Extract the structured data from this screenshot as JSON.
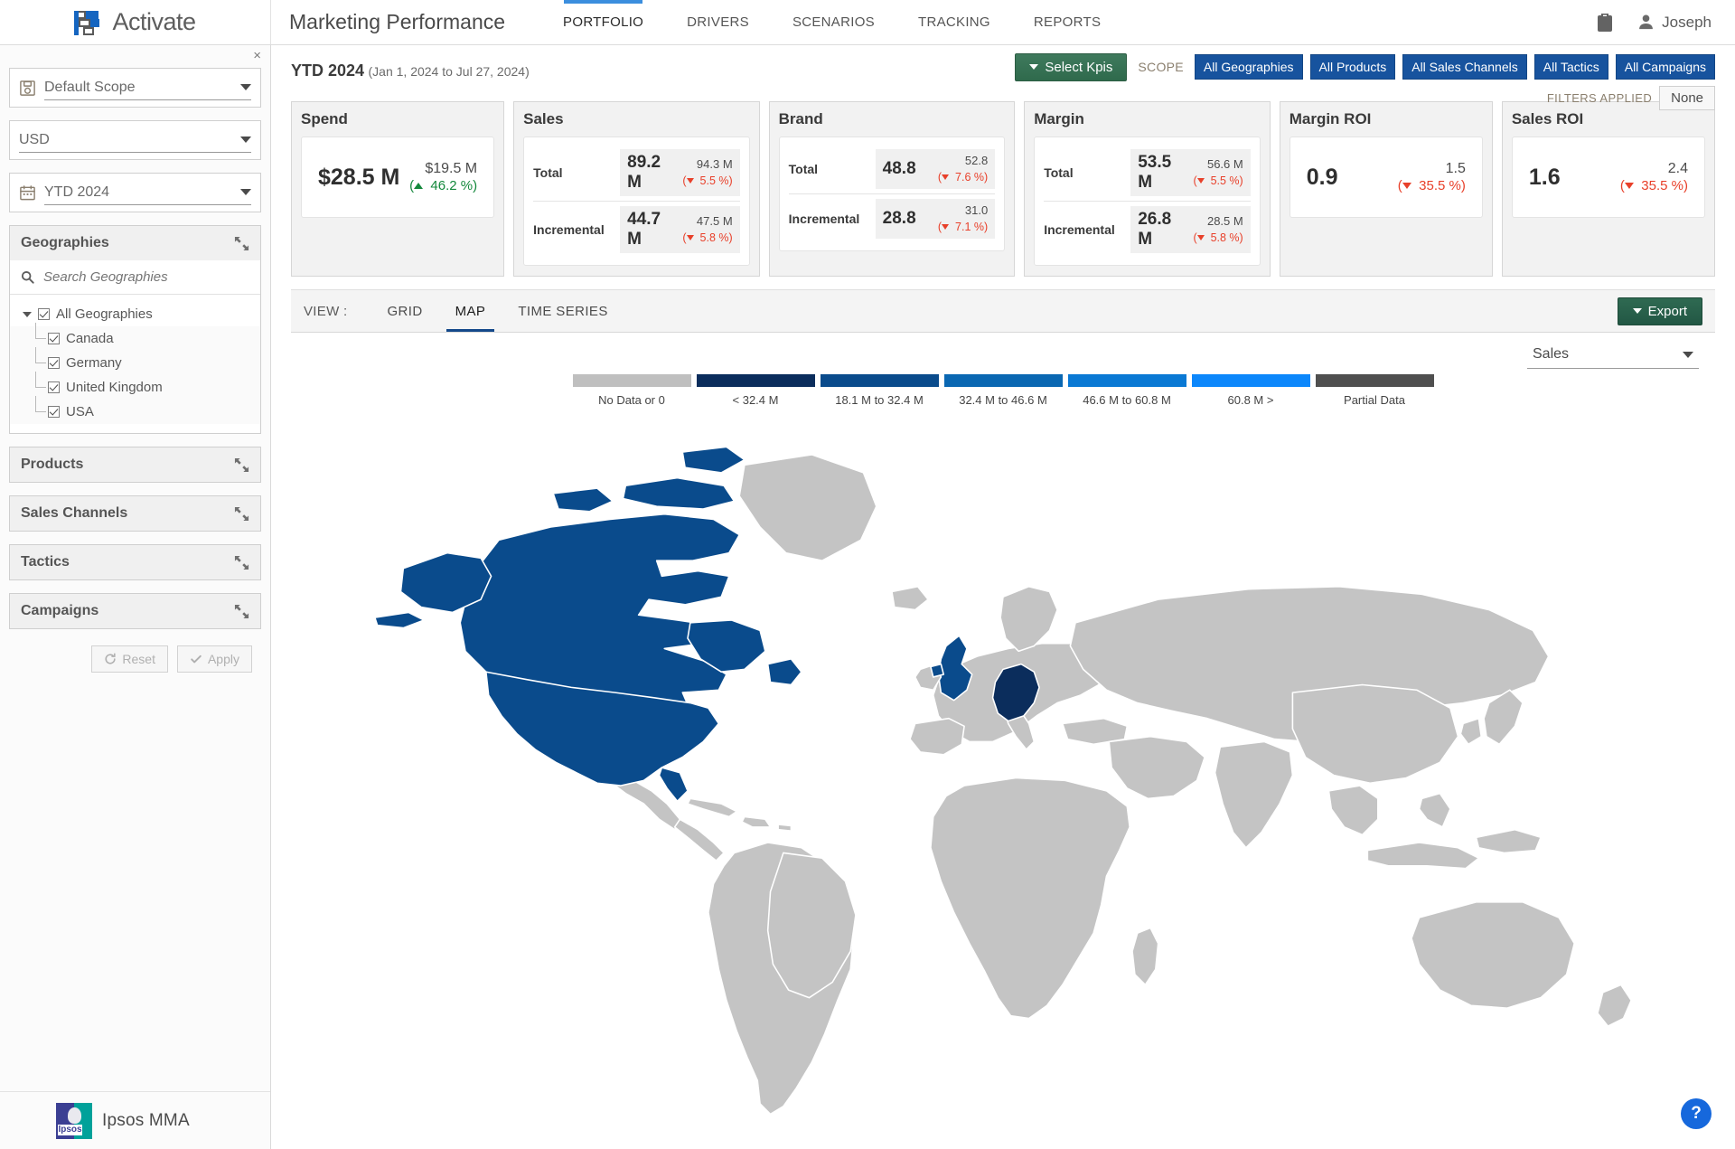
{
  "header": {
    "brand": "Activate",
    "page_title": "Marketing Performance",
    "nav": [
      {
        "label": "PORTFOLIO",
        "active": true
      },
      {
        "label": "DRIVERS",
        "active": false
      },
      {
        "label": "SCENARIOS",
        "active": false
      },
      {
        "label": "TRACKING",
        "active": false
      },
      {
        "label": "REPORTS",
        "active": false
      }
    ],
    "clipboard_icon": "clipboard-icon",
    "user_icon": "user-icon",
    "user_name": "Joseph"
  },
  "sidebar": {
    "close_label": "×",
    "scope_select": {
      "icon": "save-scope-icon",
      "value": "Default Scope"
    },
    "currency_select": {
      "value": "USD"
    },
    "period_select": {
      "icon": "calendar-icon",
      "value": "YTD 2024"
    },
    "geographies": {
      "title": "Geographies",
      "search_placeholder": "Search Geographies",
      "root": "All Geographies",
      "items": [
        "Canada",
        "Germany",
        "United Kingdom",
        "USA"
      ]
    },
    "sections": [
      {
        "title": "Products"
      },
      {
        "title": "Sales Channels"
      },
      {
        "title": "Tactics"
      },
      {
        "title": "Campaigns"
      }
    ],
    "reset_label": "Reset",
    "apply_label": "Apply",
    "footer_brand": "Ipsos MMA",
    "footer_logo_word": "Ipsos"
  },
  "toolbar": {
    "select_kpis_label": "Select Kpis",
    "scope_label": "SCOPE",
    "scope_chips": [
      "All Geographies",
      "All Products",
      "All Sales Channels",
      "All Tactics",
      "All Campaigns"
    ],
    "filters_applied_label": "FILTERS APPLIED",
    "filters_value": "None",
    "accent_green": "#2f6a4c",
    "accent_blue": "#17539e"
  },
  "period": {
    "title": "YTD 2024",
    "range": "(Jan 1, 2024 to Jul 27, 2024)"
  },
  "kpis": [
    {
      "title": "Spend",
      "layout": "single",
      "value": "$28.5 M",
      "prev": "$19.5 M",
      "delta": "46.2 %",
      "direction": "up"
    },
    {
      "title": "Sales",
      "layout": "rows",
      "rows": [
        {
          "label": "Total",
          "value": "89.2 M",
          "prev": "94.3 M",
          "delta": "5.5 %",
          "direction": "down"
        },
        {
          "label": "Incremental",
          "value": "44.7 M",
          "prev": "47.5 M",
          "delta": "5.8 %",
          "direction": "down"
        }
      ]
    },
    {
      "title": "Brand",
      "layout": "rows",
      "rows": [
        {
          "label": "Total",
          "value": "48.8",
          "prev": "52.8",
          "delta": "7.6 %",
          "direction": "down"
        },
        {
          "label": "Incremental",
          "value": "28.8",
          "prev": "31.0",
          "delta": "7.1 %",
          "direction": "down"
        }
      ]
    },
    {
      "title": "Margin",
      "layout": "rows",
      "rows": [
        {
          "label": "Total",
          "value": "53.5 M",
          "prev": "56.6 M",
          "delta": "5.5 %",
          "direction": "down"
        },
        {
          "label": "Incremental",
          "value": "26.8 M",
          "prev": "28.5 M",
          "delta": "5.8 %",
          "direction": "down"
        }
      ]
    },
    {
      "title": "Margin ROI",
      "layout": "single",
      "value": "0.9",
      "prev": "1.5",
      "delta": "35.5 %",
      "direction": "down"
    },
    {
      "title": "Sales ROI",
      "layout": "single",
      "value": "1.6",
      "prev": "2.4",
      "delta": "35.5 %",
      "direction": "down"
    }
  ],
  "view": {
    "label": "VIEW :",
    "tabs": [
      {
        "label": "GRID",
        "active": false
      },
      {
        "label": "MAP",
        "active": true
      },
      {
        "label": "TIME SERIES",
        "active": false
      }
    ],
    "export_label": "Export"
  },
  "map": {
    "metric_value": "Sales",
    "legend": [
      {
        "label": "No Data or 0",
        "color": "#bfbfbf"
      },
      {
        "label": "< 32.4 M",
        "color": "#0b2d5c"
      },
      {
        "label": "18.1 M to 32.4 M",
        "color": "#0a4b8c"
      },
      {
        "label": "32.4 M to 46.6 M",
        "color": "#0a67b2"
      },
      {
        "label": "46.6 M to 60.8 M",
        "color": "#0a79d4"
      },
      {
        "label": "60.8 M >",
        "color": "#0c87fb"
      },
      {
        "label": "Partial Data",
        "color": "#4f4f4f"
      }
    ],
    "base_color": "#c4c4c4",
    "highlighted": [
      {
        "name": "USA",
        "color": "#0a4b8c"
      },
      {
        "name": "Canada",
        "color": "#0a4b8c"
      },
      {
        "name": "United Kingdom",
        "color": "#0a4b8c"
      },
      {
        "name": "Germany",
        "color": "#0b2d5c"
      }
    ],
    "help_label": "?"
  }
}
